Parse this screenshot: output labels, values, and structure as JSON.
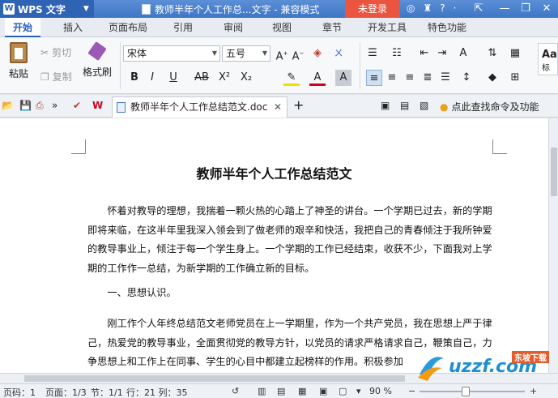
{
  "titlebar": {
    "app_name": "WPS 文字",
    "doc_title": "教师半年个人工作总...文字 - 兼容模式",
    "login_label": "未登录"
  },
  "tabs": [
    "开始",
    "插入",
    "页面布局",
    "引用",
    "审阅",
    "视图",
    "章节",
    "开发工具",
    "特色功能"
  ],
  "ribbon": {
    "paste": "粘贴",
    "cut": "剪切",
    "copy": "复制",
    "format_painter": "格式刷",
    "font_name": "宋体",
    "font_size": "五号",
    "style_preview": "Aa",
    "style_label": "标"
  },
  "quickbar": {
    "doc_tab": "教师半年个人工作总结范文.doc",
    "hint": "点此查找命令及功能"
  },
  "document": {
    "title": "教师半年个人工作总结范文",
    "paragraphs": [
      "　　怀着对教导的理想，我揣着一颗火热的心踏上了神圣的讲台。一个学期已过去，新的学期即将来临，在这半年里我深入领会到了做老师的艰辛和快活，我把自己的青春倾注于我所钟爱的教导事业上，倾注于每一个学生身上。一个学期的工作已经结束，收获不少，下面我对上学期的工作作一总结，为新学期的工作确立新的目标。",
      "　　一、思想认识。",
      "　　刚工作个人年终总结范文老师党员在上一学期里，作为一个共产党员，我在思想上严于律己，热爱党的教导事业，全面贯彻党的教导方针，以党员的请求严格请求自己，鞭策自己，力争思想上和工作上在同事、学生的心目中都建立起榜样的作用。积极参加"
    ]
  },
  "status": {
    "page_no": "页码：1",
    "pages": "页面：1/3",
    "section": "节：1/1",
    "position": "行：21  列：35",
    "zoom": "90 %"
  },
  "watermark": {
    "brand": "uzzf.com",
    "sub": "东坡下载"
  }
}
